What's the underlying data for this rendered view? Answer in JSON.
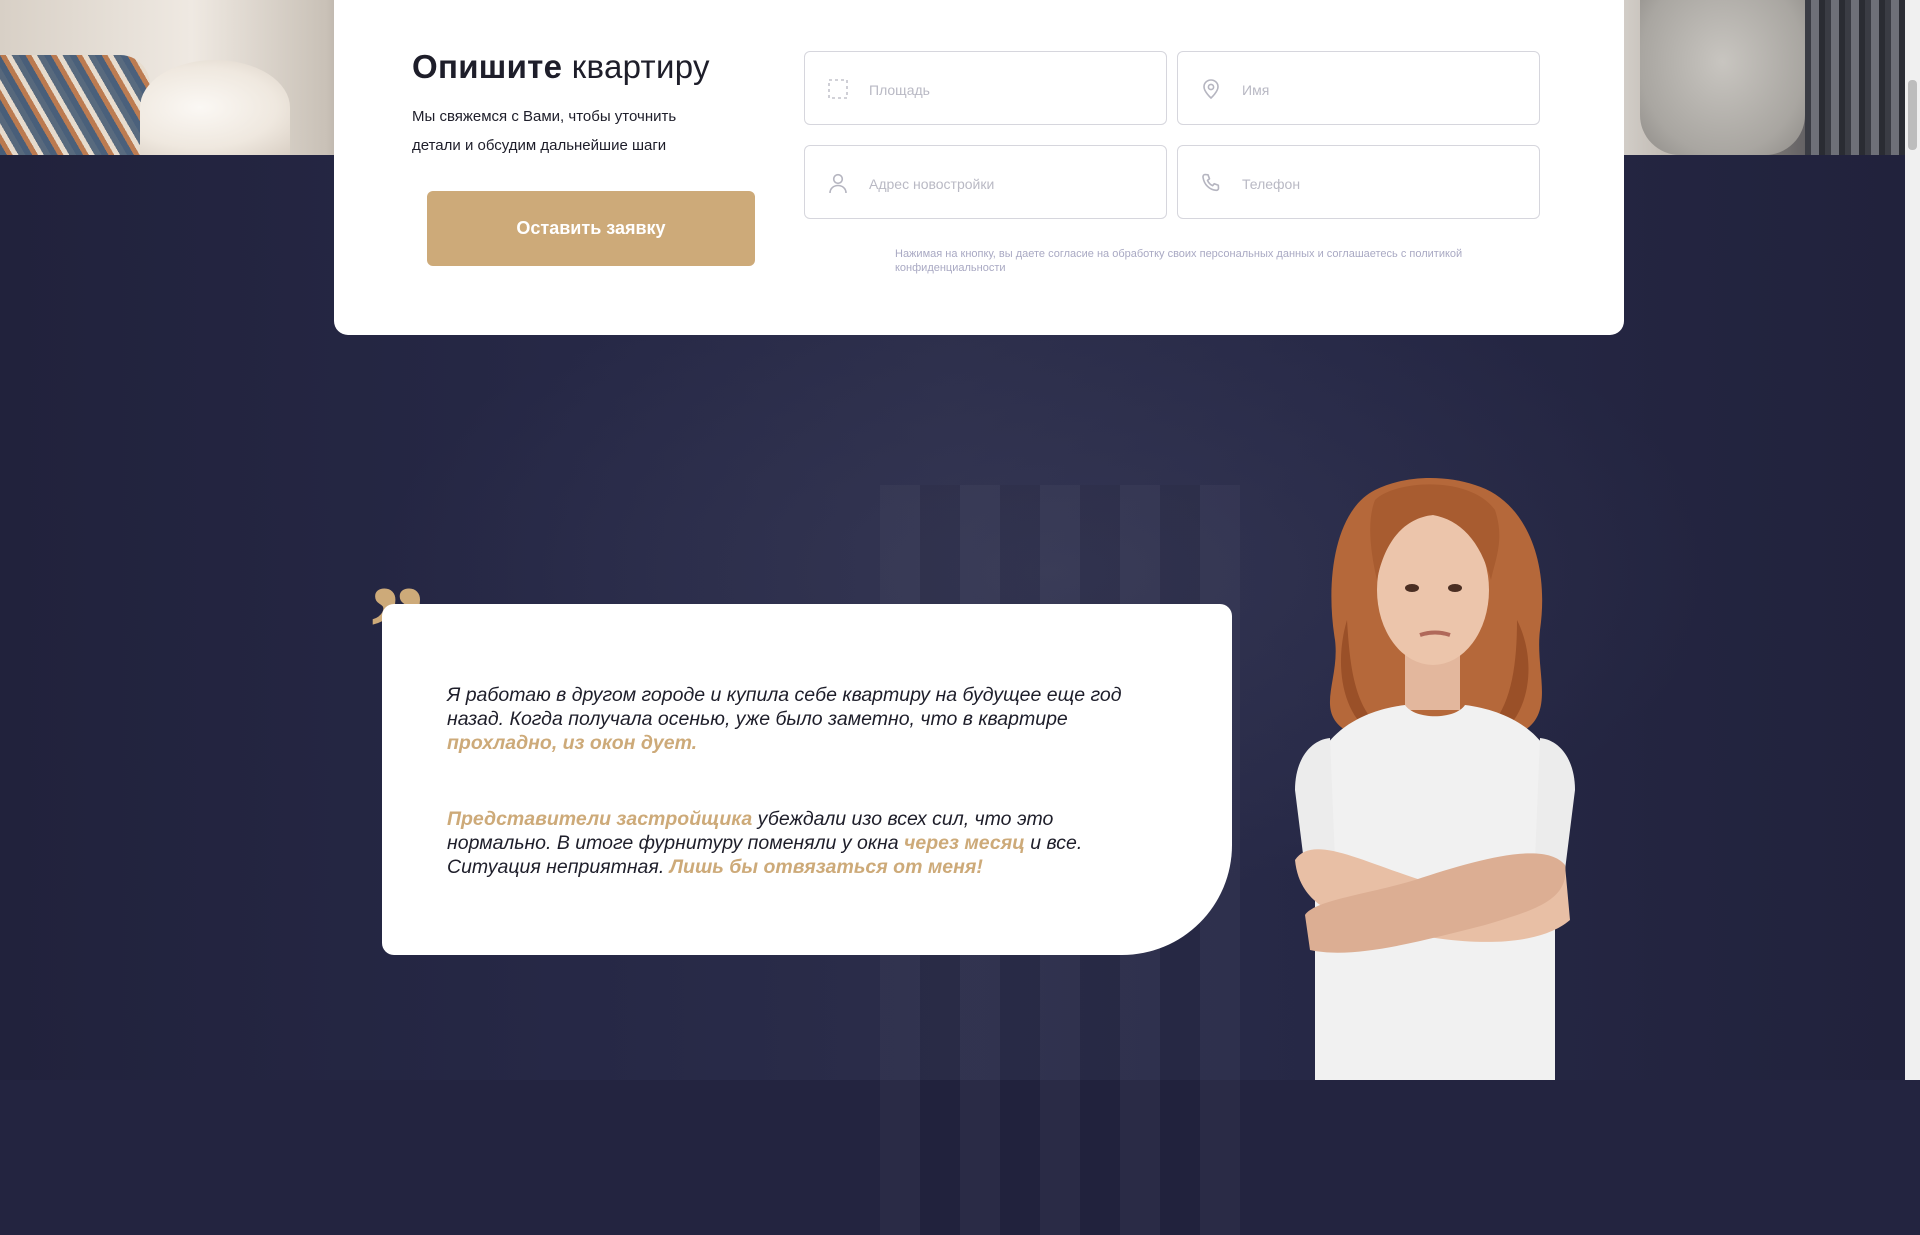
{
  "form": {
    "title_bold": "Опишите",
    "title_rest": "квартиру",
    "subtitle": "Мы свяжемся с Вами, чтобы уточнить детали и обсудим дальнейшие шаги",
    "submit_label": "Оставить заявку",
    "fields": {
      "area": {
        "placeholder": "Площадь",
        "icon": "area-dashed-square-icon"
      },
      "name": {
        "placeholder": "Имя",
        "icon": "map-pin-icon"
      },
      "address": {
        "placeholder": "Адрес новостройки",
        "icon": "user-icon"
      },
      "phone": {
        "placeholder": "Телефон",
        "icon": "phone-icon"
      }
    },
    "consent": "Нажимая на кнопку, вы даете согласие на обработку своих персональных данных и соглашаетесь с политикой конфиденциальности"
  },
  "testimonial": {
    "quote_mark": "”",
    "p1_a": "Я работаю в другом городе и купила себе квартиру на будущее еще год назад. Когда получала осенью, уже было заметно, что в квартире ",
    "p1_hl": "прохладно, из окон дует.",
    "p2_hl1": "Представители застройщика",
    "p2_a": " убеждали изо всех сил, что это нормально. В итоге фурнитуру поменяли у окна ",
    "p2_hl2": "через месяц",
    "p2_b": " и все. Ситуация неприятная. ",
    "p2_hl3": "Лишь бы отвязаться от меня!"
  },
  "colors": {
    "accent": "#cdaa79",
    "dark_bg": "#232440",
    "text": "#1e1e2a",
    "muted": "#a9a9c3"
  }
}
